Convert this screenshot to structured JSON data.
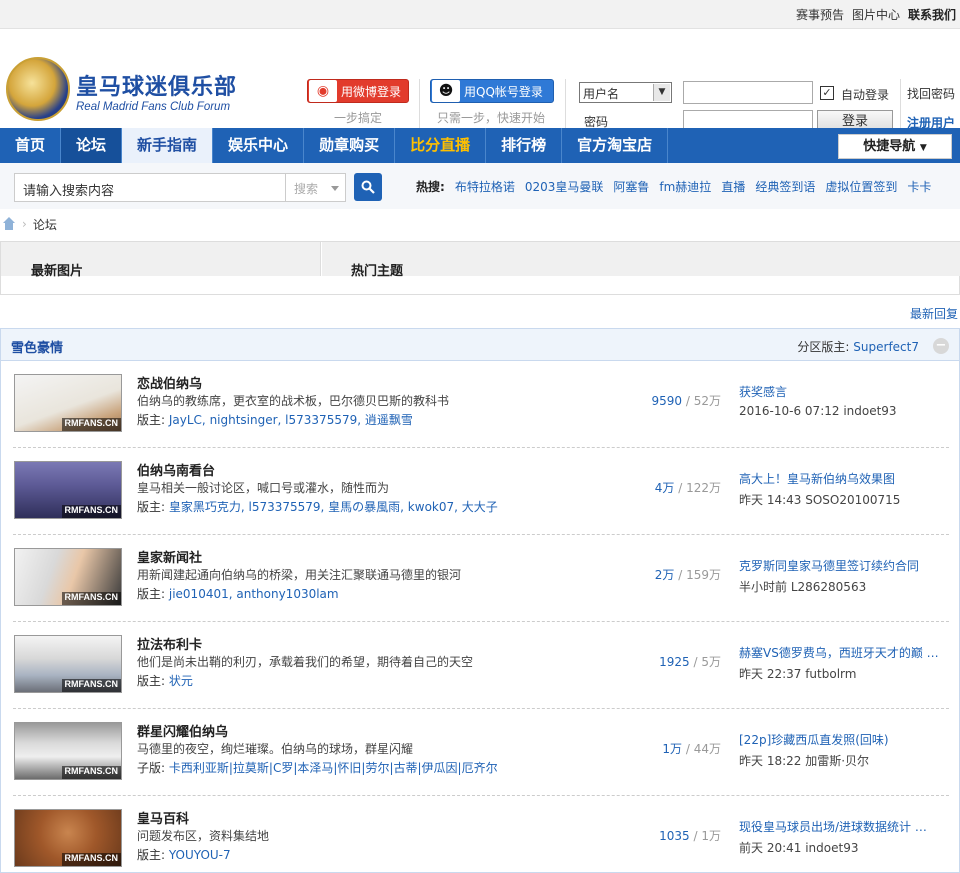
{
  "topbar": {
    "links": [
      "赛事预告",
      "图片中心",
      "联系我们"
    ]
  },
  "logo": {
    "title": "皇马球迷俱乐部",
    "subtitle": "Real Madrid Fans Club Forum"
  },
  "login": {
    "weibo_label": "用微博登录",
    "weibo_hint": "一步搞定",
    "qq_label": "用QQ帐号登录",
    "qq_hint": "只需一步，快速开始",
    "username_select": "用户名",
    "password_label": "密码",
    "auto_login": "自动登录",
    "submit": "登录",
    "find_password": "找回密码",
    "register": "注册用户"
  },
  "nav": {
    "items": [
      "首页",
      "论坛",
      "新手指南",
      "娱乐中心",
      "勋章购买",
      "比分直播",
      "排行榜",
      "官方淘宝店"
    ],
    "quick_nav": "快捷导航"
  },
  "search": {
    "placeholder": "请输入搜索内容",
    "type": "搜索",
    "hot_label": "热搜:",
    "hot": [
      "布特拉格诺",
      "0203皇马曼联",
      "阿塞鲁",
      "fm赫迪拉",
      "直播",
      "经典签到语",
      "虚拟位置签到",
      "卡卡"
    ]
  },
  "breadcrumb": {
    "current": "论坛"
  },
  "tabs": {
    "left": "最新图片",
    "right": "热门主题"
  },
  "latest_reply": "最新回复",
  "forum": {
    "title": "雪色豪情",
    "mod_label": "分区版主:",
    "mod_name": "Superfect7",
    "collapse": "−",
    "thumb_tag": "RMFANS.CN",
    "rows": [
      {
        "name": "恋战伯纳乌",
        "desc": "伯纳乌的教练席，更衣室的战术板，巴尔德贝巴斯的教科书",
        "mod_label": "版主:",
        "mods": "JayLC, nightsinger, l573375579, 逍遥飘雪",
        "threads": "9590",
        "posts": "52万",
        "last_title": "获奖感言",
        "last_meta": "2016-10-6 07:12 indoet93"
      },
      {
        "name": "伯纳乌南看台",
        "desc": "皇马相关一般讨论区，喊口号或灌水，随性而为",
        "mod_label": "版主:",
        "mods": "皇家黑巧克力, l573375579, 皇馬の暴風雨, kwok07, 大大子",
        "threads": "4万",
        "posts": "122万",
        "last_title": "高大上！皇马新伯纳乌效果图",
        "last_meta": "昨天 14:43 SOSO20100715"
      },
      {
        "name": "皇家新闻社",
        "desc": "用新闻建起通向伯纳乌的桥梁，用关注汇聚联通马德里的银河",
        "mod_label": "版主:",
        "mods": "jie010401, anthony1030lam",
        "threads": "2万",
        "posts": "159万",
        "last_title": "克罗斯同皇家马德里签订续约合同",
        "last_meta": "半小时前  L286280563"
      },
      {
        "name": "拉法布利卡",
        "desc": "他们是尚未出鞘的利刃，承载着我们的希望，期待着自己的天空",
        "mod_label": "版主:",
        "mods": "状元",
        "threads": "1925",
        "posts": "5万",
        "last_title": "赫塞VS德罗费乌，西班牙天才的巅 …",
        "last_meta": "昨天 22:37 futbolrm"
      },
      {
        "name": "群星闪耀伯纳乌",
        "desc": "马德里的夜空，绚烂璀璨。伯纳乌的球场，群星闪耀",
        "mod_label": "子版:",
        "mods": "卡西利亚斯|拉莫斯|C罗|本泽马|怀旧|劳尔|古蒂|伊瓜因|厄齐尔",
        "threads": "1万",
        "posts": "44万",
        "last_title": "[22p]珍藏西瓜直发照(回味)",
        "last_meta": "昨天 18:22 加雷斯·贝尔"
      },
      {
        "name": "皇马百科",
        "desc": "问题发布区，资料集结地",
        "mod_label": "版主:",
        "mods": "YOUYOU-7",
        "threads": "1035",
        "posts": "1万",
        "last_title": "现役皇马球员出场/进球数据统计 …",
        "last_meta": "前天 20:41 indoet93"
      }
    ]
  },
  "colors": {
    "nav_blue": "#1f62b5",
    "weibo_red": "#e23b2c",
    "qq_blue": "#2f79d6",
    "link_blue": "#1f62b5"
  }
}
